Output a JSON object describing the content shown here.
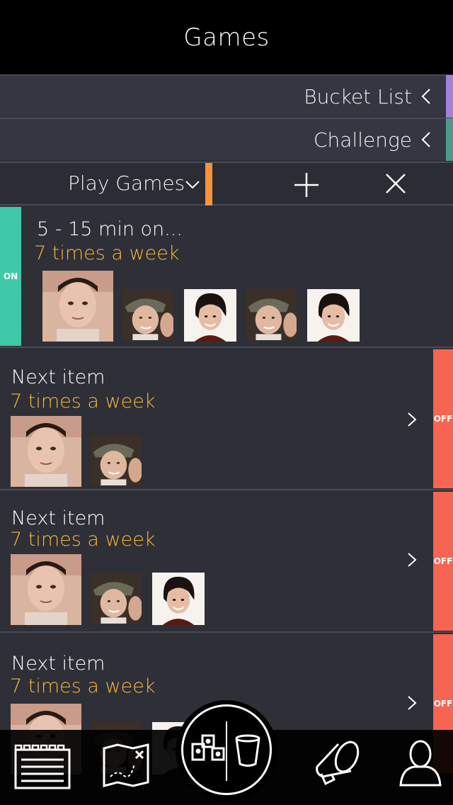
{
  "header": {
    "title": "Games"
  },
  "menu": [
    {
      "label": "Bucket List",
      "accent": "#a080d8"
    },
    {
      "label": "Challenge",
      "accent": "#4c9a8c"
    }
  ],
  "toolbar": {
    "selected": "Play Games",
    "accent": "#f7943a"
  },
  "items": [
    {
      "name": "5 - 15 min on...",
      "frequency": "7 times a week",
      "status": "ON"
    },
    {
      "name": "Next item",
      "frequency": "7 times a week",
      "status": "OFF"
    },
    {
      "name": "Next item",
      "frequency": "7 times a week",
      "status": "OFF"
    },
    {
      "name": "Next item",
      "frequency": "7 times a week",
      "status": "OFF"
    }
  ],
  "tabbar": {
    "icons": [
      "list-icon",
      "map-icon",
      "leaderboard-icon",
      "cup-icon",
      "megaphone-icon",
      "profile-icon"
    ]
  },
  "colors": {
    "on": "#3fc8a8",
    "off": "#f66552",
    "frequency": "#f6b63c"
  }
}
